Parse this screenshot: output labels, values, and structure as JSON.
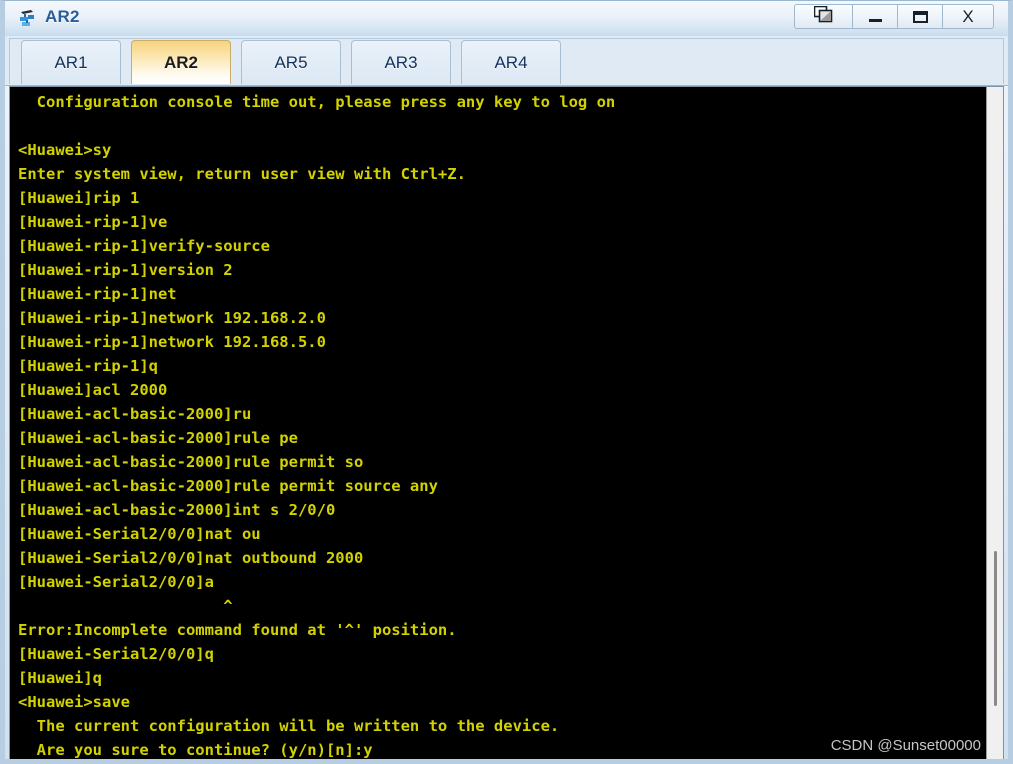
{
  "window": {
    "title": "AR2",
    "icon": "router-icon",
    "buttons": [
      {
        "name": "restore-windows-button",
        "label": "❐",
        "glyph": "cascade-windows-icon"
      },
      {
        "name": "minimize-button",
        "label": "–",
        "glyph": "minimize-icon"
      },
      {
        "name": "maximize-button",
        "label": "□",
        "glyph": "maximize-icon"
      },
      {
        "name": "close-button",
        "label": "X",
        "glyph": "close-icon"
      }
    ]
  },
  "tabs": [
    {
      "label": "AR1",
      "active": false
    },
    {
      "label": "AR2",
      "active": true
    },
    {
      "label": "AR5",
      "active": false
    },
    {
      "label": "AR3",
      "active": false
    },
    {
      "label": "AR4",
      "active": false
    }
  ],
  "terminal": {
    "foreground": "#d2d200",
    "background": "#000000",
    "lines": [
      "  Configuration console time out, please press any key to log on",
      "",
      "<Huawei>sy",
      "Enter system view, return user view with Ctrl+Z.",
      "[Huawei]rip 1",
      "[Huawei-rip-1]ve",
      "[Huawei-rip-1]verify-source",
      "[Huawei-rip-1]version 2",
      "[Huawei-rip-1]net",
      "[Huawei-rip-1]network 192.168.2.0",
      "[Huawei-rip-1]network 192.168.5.0",
      "[Huawei-rip-1]q",
      "[Huawei]acl 2000",
      "[Huawei-acl-basic-2000]ru",
      "[Huawei-acl-basic-2000]rule pe",
      "[Huawei-acl-basic-2000]rule permit so",
      "[Huawei-acl-basic-2000]rule permit source any",
      "[Huawei-acl-basic-2000]int s 2/0/0",
      "[Huawei-Serial2/0/0]nat ou",
      "[Huawei-Serial2/0/0]nat outbound 2000",
      "[Huawei-Serial2/0/0]a",
      "                      ^",
      "Error:Incomplete command found at '^' position.",
      "[Huawei-Serial2/0/0]q",
      "[Huawei]q",
      "<Huawei>save",
      "  The current configuration will be written to the device.",
      "  Are you sure to continue? (y/n)[n]:y"
    ]
  },
  "scrollbar": {
    "orientation": "vertical",
    "thumb_top_pct": 69,
    "thumb_height_pct": 23
  },
  "watermark": {
    "text": "CSDN @Sunset00000"
  }
}
